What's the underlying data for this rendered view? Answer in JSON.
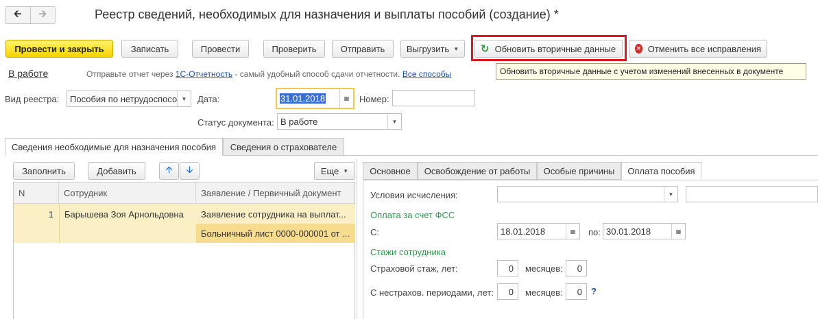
{
  "window": {
    "title": "Реестр сведений, необходимых для назначения и выплаты пособий (создание) *"
  },
  "nav": {
    "back_icon": "arrow-left-icon",
    "forward_icon": "arrow-right-icon"
  },
  "toolbar": {
    "post_close": "Провести и закрыть",
    "save": "Записать",
    "post": "Провести",
    "check": "Проверить",
    "send": "Отправить",
    "export": "Выгрузить",
    "refresh": "Обновить вторичные данные",
    "cancel_all": "Отменить все исправления"
  },
  "tooltip": "Обновить вторичные данные с учетом изменений внесенных в документе",
  "status_bar": {
    "status": "В работе",
    "hint_prefix": "Отправьте отчет через",
    "hint_link": "1С-Отчетность",
    "hint_suffix": "- самый удобный способ сдачи отчетности.",
    "all_methods": "Все способы"
  },
  "form": {
    "registry_type_label": "Вид реестра:",
    "registry_type_value": "Пособия по нетрудоспосо",
    "date_label": "Дата:",
    "date_value": "31.01.2018",
    "number_label": "Номер:",
    "number_value": "",
    "doc_status_label": "Статус документа:",
    "doc_status_value": "В работе"
  },
  "main_tabs": [
    "Сведения необходимые для назначения пособия",
    "Сведения о страхователе"
  ],
  "left_toolbar": {
    "fill": "Заполнить",
    "add": "Добавить",
    "more": "Еще"
  },
  "table": {
    "columns": [
      "N",
      "Сотрудник",
      "Заявление / Первичный документ"
    ],
    "rows": [
      {
        "n": "1",
        "employee": "Барышева Зоя Арнольдовна",
        "doc1": "Заявление сотрудника на выплат...",
        "doc2": "Больничный лист 0000-000001 от ..."
      }
    ]
  },
  "right_tabs": [
    "Основное",
    "Освобождение от работы",
    "Особые причины",
    "Оплата пособия"
  ],
  "payment": {
    "conditions_label": "Условия исчисления:",
    "conditions_value": "",
    "fss_section": "Оплата за счет ФСС",
    "from_label": "С:",
    "from_value": "18.01.2018",
    "to_label": "по:",
    "to_value": "30.01.2018",
    "experience_section": "Стажи сотрудника",
    "insured_label": "Страховой стаж, лет:",
    "insured_years": "0",
    "months_label": "месяцев:",
    "insured_months": "0",
    "noninsured_label": "С нестрахов. периодами, лет:",
    "noninsured_years": "0",
    "noninsured_months": "0",
    "help": "?"
  },
  "colors": {
    "primary_button": "#f5d300",
    "highlight": "#e0161f",
    "section_green": "#2c9a4e",
    "row_selected": "#fbefc6",
    "cell_selected": "#f8dc8e",
    "link": "#1a4fb4"
  }
}
